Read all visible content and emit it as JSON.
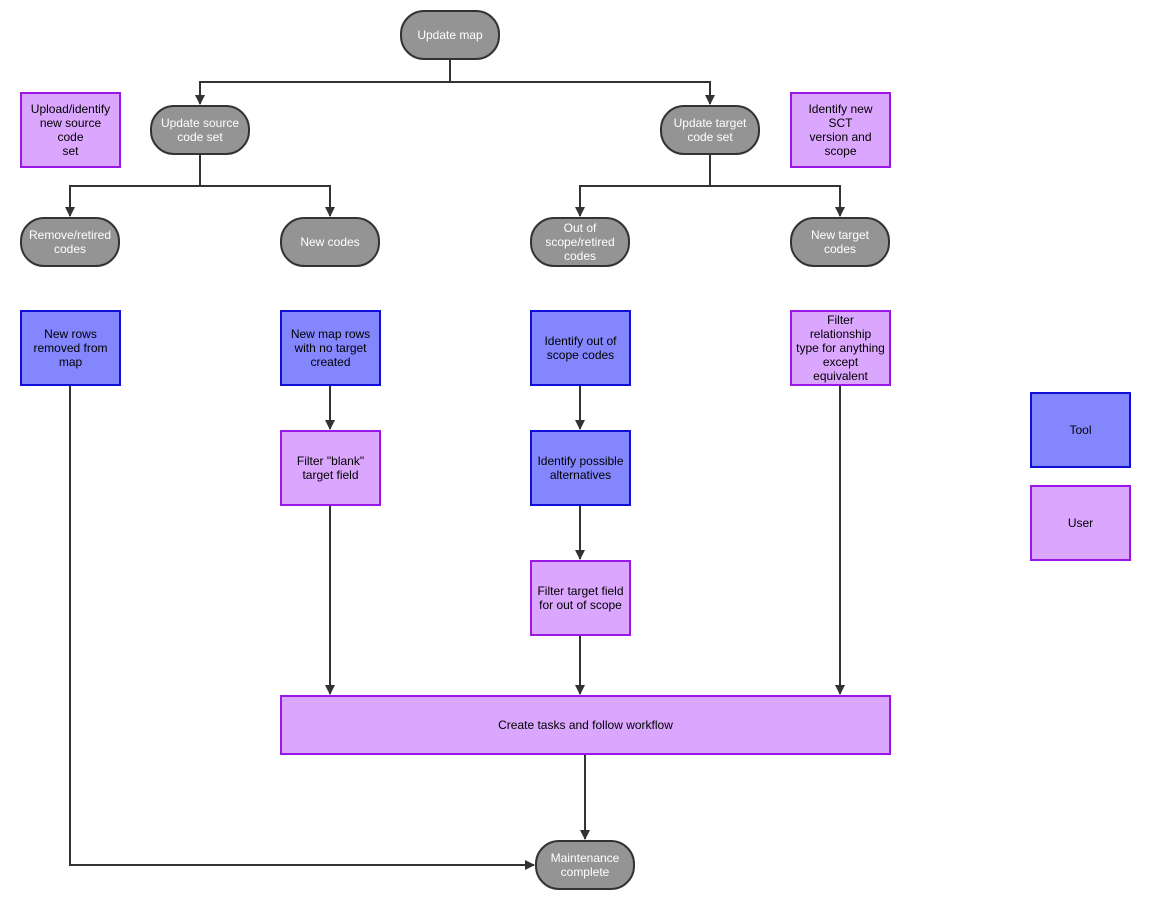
{
  "colors": {
    "terminal_fill": "#949494",
    "terminal_stroke": "#333333",
    "tool_fill": "#8486fd",
    "tool_stroke": "#0f0fd8",
    "user_fill": "#dba6fd",
    "user_stroke": "#9a17e8",
    "edge": "#333333"
  },
  "nodes": {
    "update_map": "Update map",
    "update_source": "Update source\ncode set",
    "update_target": "Update target\ncode set",
    "upload_source": "Upload/identify\nnew source code\nset",
    "identify_sct": "Identify new SCT\nversion and\nscope",
    "remove_retired": "Remove/retired\ncodes",
    "new_codes": "New codes",
    "out_of_scope": "Out of\nscope/retired\ncodes",
    "new_target_codes": "New target codes",
    "new_rows_removed": "New rows\nremoved from\nmap",
    "new_map_rows": "New map rows\nwith no target\ncreated",
    "identify_out_scope": "Identify out of\nscope codes",
    "filter_relationship": "Filter relationship\ntype for anything\nexcept equivalent",
    "filter_blank": "Filter \"blank\"\ntarget field",
    "identify_alternatives": "Identify possible\nalternatives",
    "filter_target_field": "Filter target field\nfor out of scope",
    "create_tasks": "Create tasks and follow workflow",
    "maintenance_complete": "Maintenance\ncomplete"
  },
  "legend": {
    "tool": "Tool",
    "user": "User"
  }
}
